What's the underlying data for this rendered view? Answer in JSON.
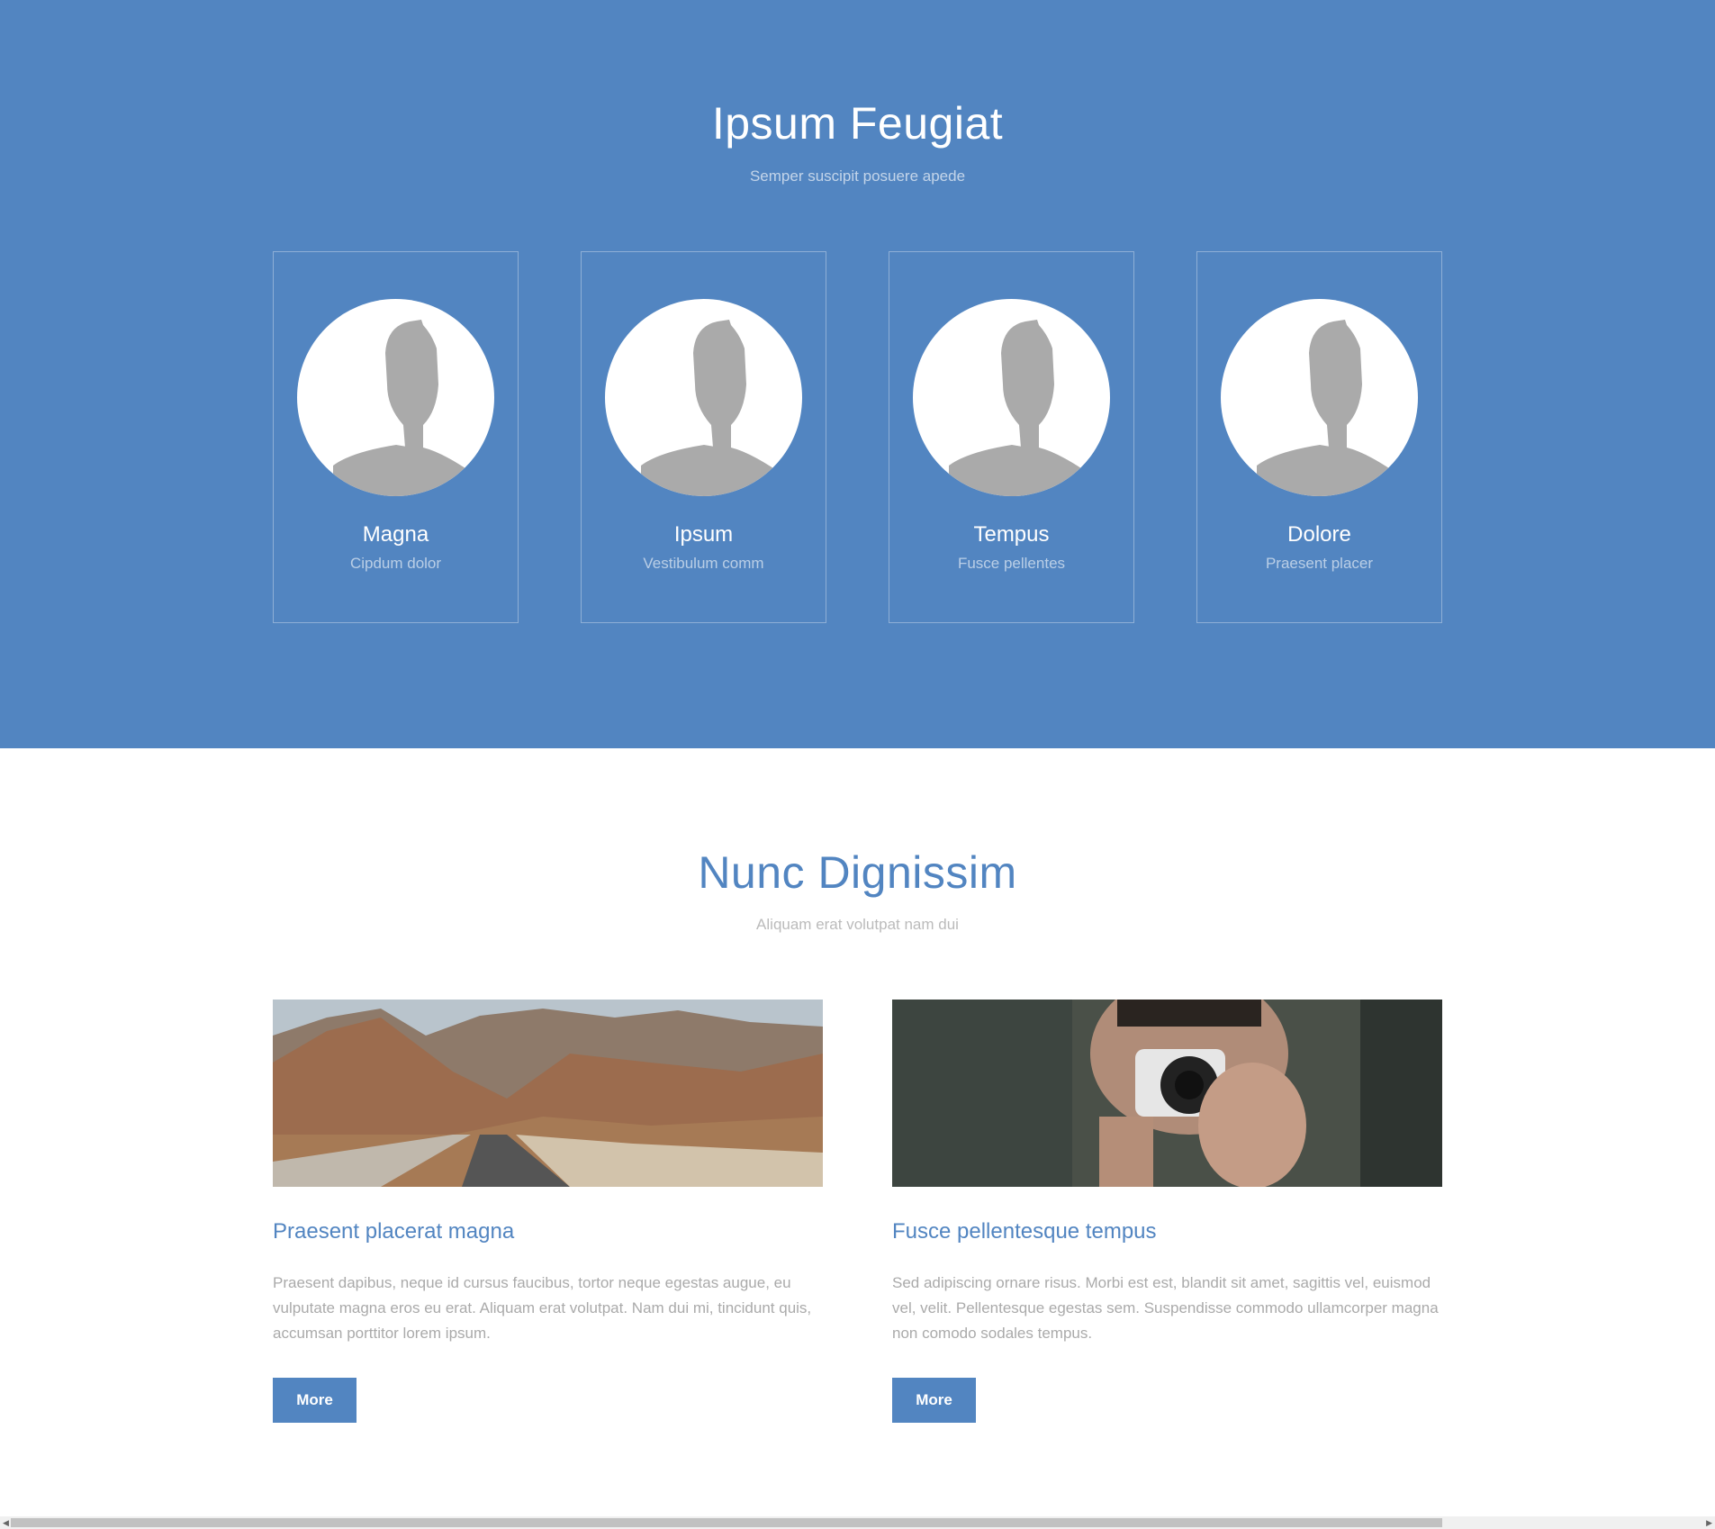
{
  "team": {
    "title": "Ipsum Feugiat",
    "subtitle": "Semper suscipit posuere apede",
    "members": [
      {
        "name": "Magna",
        "role": "Cipdum dolor"
      },
      {
        "name": "Ipsum",
        "role": "Vestibulum comm"
      },
      {
        "name": "Tempus",
        "role": "Fusce pellentes"
      },
      {
        "name": "Dolore",
        "role": "Praesent placer"
      }
    ]
  },
  "news": {
    "title": "Nunc Dignissim",
    "subtitle": "Aliquam erat volutpat nam dui",
    "posts": [
      {
        "heading": "Praesent placerat magna",
        "body": "Praesent dapibus, neque id cursus faucibus, tortor neque egestas augue, eu vulputate magna eros eu erat. Aliquam erat volutpat. Nam dui mi, tincidunt quis, accumsan porttitor lorem ipsum.",
        "button": "More"
      },
      {
        "heading": "Fusce pellentesque tempus",
        "body": "Sed adipiscing ornare risus. Morbi est est, blandit sit amet, sagittis vel, euismod vel, velit. Pellentesque egestas sem. Suspendisse commodo ullamcorper magna non comodo sodales tempus.",
        "button": "More"
      }
    ]
  },
  "colors": {
    "brand": "#5285c1"
  }
}
